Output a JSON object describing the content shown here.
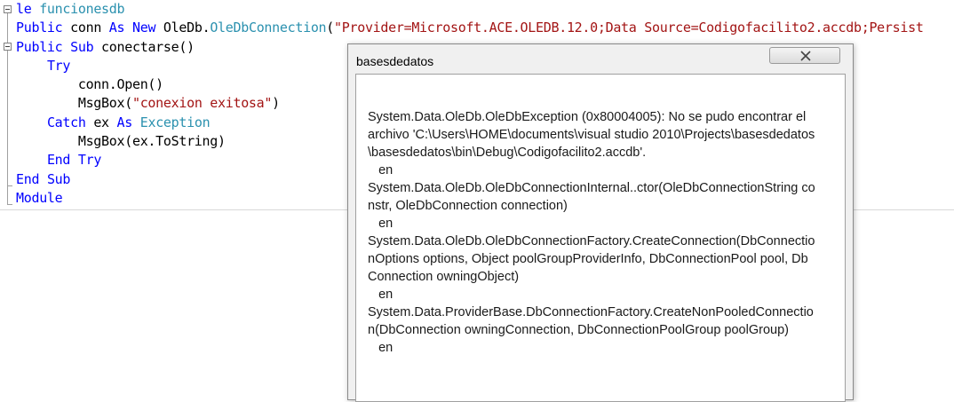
{
  "editor": {
    "lines": [
      [
        {
          "t": "le ",
          "c": "kw"
        },
        {
          "t": "funcionesdb",
          "c": "tp"
        }
      ],
      [
        {
          "t": "Public",
          "c": "kw"
        },
        {
          "t": " conn ",
          "c": ""
        },
        {
          "t": "As",
          "c": "kw"
        },
        {
          "t": " ",
          "c": ""
        },
        {
          "t": "New",
          "c": "kw"
        },
        {
          "t": " OleDb.",
          "c": ""
        },
        {
          "t": "OleDbConnection",
          "c": "tp"
        },
        {
          "t": "(",
          "c": ""
        },
        {
          "t": "\"Provider=Microsoft.ACE.OLEDB.12.0;Data Source=Codigofacilito2.accdb;Persist",
          "c": "st"
        }
      ],
      [
        {
          "t": "Public",
          "c": "kw"
        },
        {
          "t": " ",
          "c": ""
        },
        {
          "t": "Sub",
          "c": "kw"
        },
        {
          "t": " conectarse()",
          "c": ""
        }
      ],
      [
        {
          "t": "    ",
          "c": ""
        },
        {
          "t": "Try",
          "c": "kw"
        }
      ],
      [
        {
          "t": "        conn.Open()",
          "c": ""
        }
      ],
      [
        {
          "t": "        MsgBox(",
          "c": ""
        },
        {
          "t": "\"conexion exitosa\"",
          "c": "st"
        },
        {
          "t": ")",
          "c": ""
        }
      ],
      [
        {
          "t": "    ",
          "c": ""
        },
        {
          "t": "Catch",
          "c": "kw"
        },
        {
          "t": " ex ",
          "c": ""
        },
        {
          "t": "As",
          "c": "kw"
        },
        {
          "t": " ",
          "c": ""
        },
        {
          "t": "Exception",
          "c": "tp"
        }
      ],
      [
        {
          "t": "        MsgBox(ex.ToString)",
          "c": ""
        }
      ],
      [
        {
          "t": "    ",
          "c": ""
        },
        {
          "t": "End",
          "c": "kw"
        },
        {
          "t": " ",
          "c": ""
        },
        {
          "t": "Try",
          "c": "kw"
        }
      ],
      [
        {
          "t": "End",
          "c": "kw"
        },
        {
          "t": " ",
          "c": ""
        },
        {
          "t": "Sub",
          "c": "kw"
        }
      ],
      [
        {
          "t": "Module",
          "c": "kw"
        }
      ]
    ]
  },
  "dialog": {
    "title": "basesdedatos",
    "message": "System.Data.OleDb.OleDbException (0x80004005): No se pudo encontrar el archivo 'C:\\Users\\HOME\\documents\\visual studio 2010\\Projects\\basesdedatos\\basesdedatos\\bin\\Debug\\Codigofacilito2.accdb'.\n   en\nSystem.Data.OleDb.OleDbConnectionInternal..ctor(OleDbConnectionString constr, OleDbConnection connection)\n   en\nSystem.Data.OleDb.OleDbConnectionFactory.CreateConnection(DbConnectionOptions options, Object poolGroupProviderInfo, DbConnectionPool pool, DbConnection owningObject)\n   en\nSystem.Data.ProviderBase.DbConnectionFactory.CreateNonPooledConnection(DbConnection owningConnection, DbConnectionPoolGroup poolGroup)\n   en",
    "close_icon": "close-icon"
  },
  "colors": {
    "keyword": "#0000ff",
    "type": "#2b91af",
    "string": "#a31515"
  }
}
